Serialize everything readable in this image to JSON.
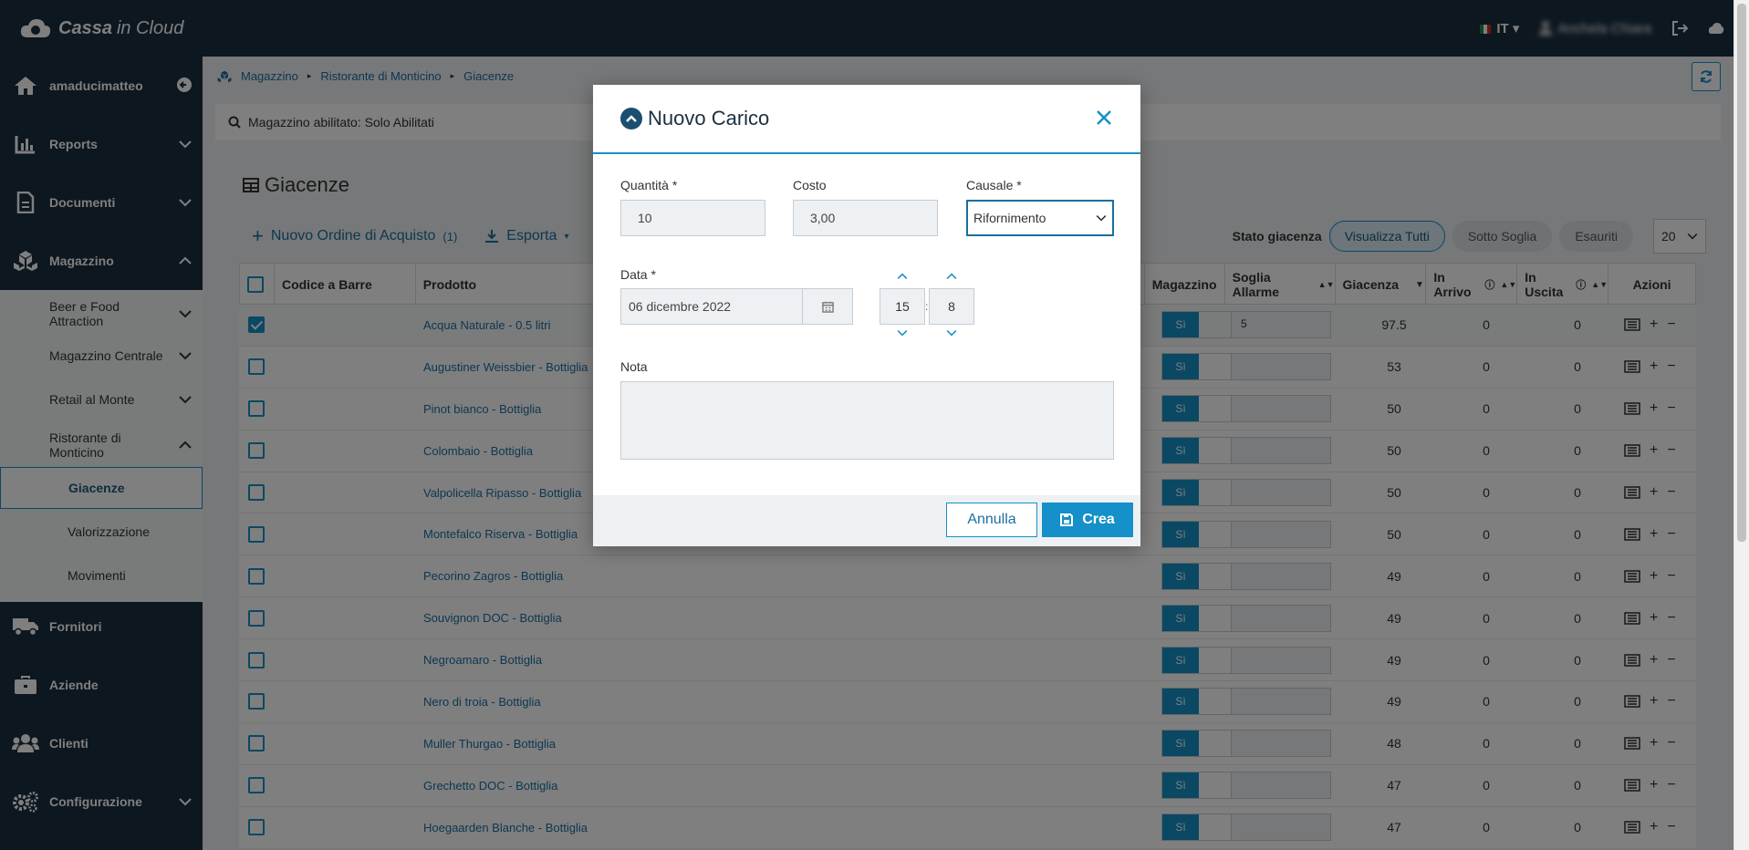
{
  "brand": {
    "name_bold": "Cassa",
    "name_rest": "in Cloud"
  },
  "topbar": {
    "language": "IT",
    "user": "Anchela Chiara"
  },
  "sidebar": {
    "user": "amaducimatteo",
    "items": [
      {
        "label": "Reports",
        "icon": "chart-icon"
      },
      {
        "label": "Documenti",
        "icon": "document-icon"
      },
      {
        "label": "Magazzino",
        "icon": "boxes-icon"
      },
      {
        "label": "Fornitori",
        "icon": "truck-icon"
      },
      {
        "label": "Aziende",
        "icon": "briefcase-icon"
      },
      {
        "label": "Clienti",
        "icon": "users-icon"
      },
      {
        "label": "Configurazione",
        "icon": "gears-icon"
      }
    ],
    "sub_items": [
      "Beer e Food Attraction",
      "Magazzino Centrale",
      "Retail al Monte",
      "Ristorante di Monticino"
    ],
    "sub_sub_items": [
      "Giacenze",
      "Valorizzazione",
      "Movimenti"
    ]
  },
  "breadcrumb": [
    "Magazzino",
    "Ristorante di Monticino",
    "Giacenze"
  ],
  "filter": {
    "text": "Magazzino abilitato: Solo Abilitati"
  },
  "page": {
    "title": "Giacenze"
  },
  "actions": {
    "new_order": "Nuovo Ordine di Acquisto",
    "new_order_count": "(1)",
    "export": "Esporta"
  },
  "stato": {
    "label": "Stato giacenza",
    "pills": [
      "Visualizza Tutti",
      "Sotto Soglia",
      "Esauriti"
    ],
    "per_page": "20"
  },
  "table": {
    "headers": [
      "Codice a Barre",
      "Prodotto",
      "Magazzino",
      "Soglia Allarme",
      "Giacenza",
      "In Arrivo",
      "In Uscita",
      "Azioni"
    ],
    "toggle_label": "Sì",
    "rows": [
      {
        "product": "Acqua Naturale - 0.5 litri",
        "soglia": "5",
        "giacenza": "97.5",
        "arrivo": "0",
        "uscita": "0"
      },
      {
        "product": "Augustiner Weissbier - Bottiglia",
        "soglia": "",
        "giacenza": "53",
        "arrivo": "0",
        "uscita": "0"
      },
      {
        "product": "Pinot bianco - Bottiglia",
        "soglia": "",
        "giacenza": "50",
        "arrivo": "0",
        "uscita": "0"
      },
      {
        "product": "Colombaio - Bottiglia",
        "soglia": "",
        "giacenza": "50",
        "arrivo": "0",
        "uscita": "0"
      },
      {
        "product": "Valpolicella Ripasso - Bottiglia",
        "soglia": "",
        "giacenza": "50",
        "arrivo": "0",
        "uscita": "0"
      },
      {
        "product": "Montefalco Riserva - Bottiglia",
        "soglia": "",
        "giacenza": "50",
        "arrivo": "0",
        "uscita": "0"
      },
      {
        "product": "Pecorino Zagros - Bottiglia",
        "soglia": "",
        "giacenza": "49",
        "arrivo": "0",
        "uscita": "0"
      },
      {
        "product": "Souvignon DOC - Bottiglia",
        "soglia": "",
        "giacenza": "49",
        "arrivo": "0",
        "uscita": "0"
      },
      {
        "product": "Negroamaro - Bottiglia",
        "soglia": "",
        "giacenza": "49",
        "arrivo": "0",
        "uscita": "0"
      },
      {
        "product": "Nero di troia - Bottiglia",
        "soglia": "",
        "giacenza": "49",
        "arrivo": "0",
        "uscita": "0"
      },
      {
        "product": "Muller Thurgao - Bottiglia",
        "soglia": "",
        "giacenza": "48",
        "arrivo": "0",
        "uscita": "0"
      },
      {
        "product": "Grechetto DOC - Bottiglia",
        "soglia": "",
        "giacenza": "47",
        "arrivo": "0",
        "uscita": "0"
      },
      {
        "product": "Hoegaarden Blanche - Bottiglia",
        "soglia": "",
        "giacenza": "47",
        "arrivo": "0",
        "uscita": "0"
      }
    ]
  },
  "modal": {
    "title": "Nuovo Carico",
    "quantita_label": "Quantità *",
    "quantita_value": "10",
    "costo_label": "Costo",
    "costo_value": "3,00",
    "causale_label": "Causale *",
    "causale_value": "Rifornimento",
    "data_label": "Data *",
    "data_value": "06 dicembre 2022",
    "hour": "15",
    "minute": "8",
    "time_sep": ":",
    "nota_label": "Nota",
    "cancel": "Annulla",
    "create": "Crea"
  },
  "colors": {
    "accent": "#1590c8",
    "dark": "#1b2f3f"
  }
}
